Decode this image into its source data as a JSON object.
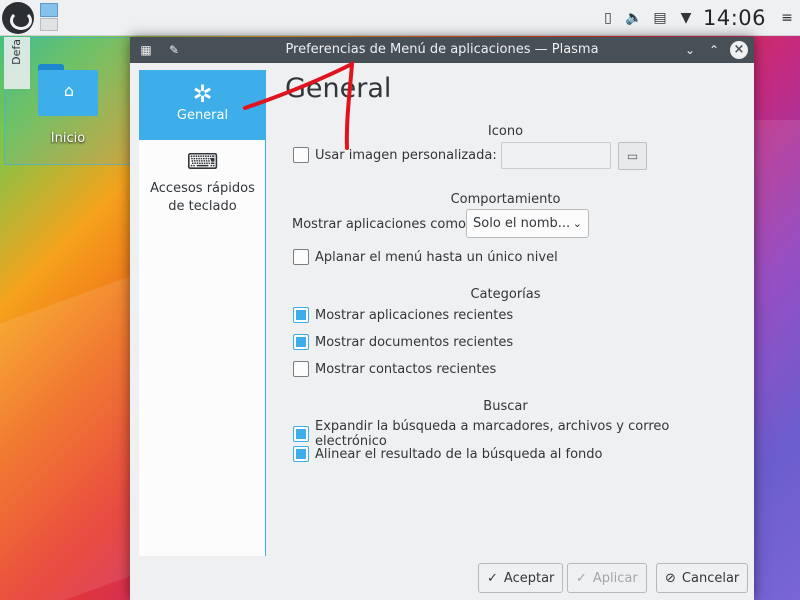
{
  "panel": {
    "clock": "14:06",
    "tray_icons": [
      "usb-icon",
      "volume-icon",
      "clipboard-icon",
      "arrow-down-icon",
      "hamburger-icon"
    ]
  },
  "desktop": {
    "folderview_label": "Defa",
    "folder_label": "Inicio"
  },
  "window": {
    "title": "Preferencias de Menú de aplicaciones — Plasma"
  },
  "sidebar": {
    "items": [
      {
        "label": "General",
        "icon": "kde-logo-icon",
        "active": true
      },
      {
        "label": "Accesos rápidos de teclado",
        "icon": "keyboard-icon",
        "active": false
      }
    ]
  },
  "main": {
    "heading": "General",
    "icon_section": {
      "title": "Icono",
      "custom_image_label": "Usar imagen personalizada:",
      "custom_image_checked": false,
      "path_value": ""
    },
    "behavior_section": {
      "title": "Comportamiento",
      "show_apps_label": "Mostrar aplicaciones como:",
      "show_apps_value": "Solo el nomb...",
      "flatten_label": "Aplanar el menú hasta un único nivel",
      "flatten_checked": false
    },
    "categories_section": {
      "title": "Categorías",
      "recent_apps_label": "Mostrar aplicaciones recientes",
      "recent_apps_checked": true,
      "recent_docs_label": "Mostrar documentos recientes",
      "recent_docs_checked": true,
      "recent_contacts_label": "Mostrar contactos recientes",
      "recent_contacts_checked": false
    },
    "search_section": {
      "title": "Buscar",
      "expand_label": "Expandir la búsqueda a marcadores, archivos y correo electrónico",
      "expand_checked": true,
      "align_label": "Alinear el resultado de la búsqueda al fondo",
      "align_checked": true
    }
  },
  "buttons": {
    "ok": "Aceptar",
    "apply": "Aplicar",
    "cancel": "Cancelar"
  },
  "colors": {
    "accent": "#3daee9",
    "titlebar": "#475057",
    "annotation": "#e0141e"
  }
}
